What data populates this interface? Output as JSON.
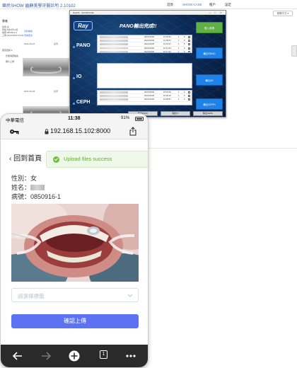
{
  "desktop": {
    "app_title": "樂民SHOW 齒顧美學牙醫診所 2.10102",
    "menu": [
      "首頁",
      "SHOW CASE",
      "帳戶",
      "設定"
    ],
    "lang_button": "繁體中文 ▾",
    "patient_heading": "患者",
    "patient_lines": [
      "性別:女",
      "年齡:5歲2月13日",
      "病歷:0850916-1",
      "上傳:2021/09/06 03:25"
    ],
    "links": [
      "資料看板",
      "查看更多"
    ],
    "menu_items": [
      "首頁選擇 ▾",
      "影像病歷檔案",
      "圖片上傳"
    ],
    "dates": [
      "2021-09-07",
      "2021-09-06"
    ],
    "date_tags": [
      "全景",
      "全景"
    ]
  },
  "ray": {
    "titlebar": "Ray5/6 · SHOWCASE",
    "window_controls": [
      "—",
      "□",
      "✕"
    ],
    "logo": "Ray",
    "heading": "PANO輸出完成!!",
    "sections": [
      {
        "label": "PANO",
        "rows": [
          {
            "date": "2021/04/06",
            "time": "16:49:53",
            "a": "1",
            "b": "5"
          },
          {
            "date": "2021/04/06",
            "time": "10:38:57",
            "a": "1",
            "b": "5"
          },
          {
            "date": "2021/04/06",
            "time": "10:15:47",
            "a": "1",
            "b": "5"
          },
          {
            "date": "2021/04/06",
            "time": "10:12:53",
            "a": "1",
            "b": "5"
          },
          {
            "date": "2021/04/06",
            "time": "15:17:42",
            "a": "1",
            "b": "5"
          }
        ]
      },
      {
        "label": "IO",
        "rows": []
      },
      {
        "label": "CEPH",
        "rows": [
          {
            "date": "2021/04/06",
            "time": "16:42:40",
            "a": "1",
            "b": "6"
          },
          {
            "date": "2021/04/06",
            "time": "16:36:16",
            "a": "1",
            "b": "6"
          },
          {
            "date": "2021/04/06",
            "time": "16:28:87",
            "a": "1",
            "b": "6"
          }
        ]
      }
    ],
    "buttons": {
      "login": "登入查詢",
      "export_pano": "輸出PANO",
      "export_io": "輸出IO",
      "export_ceph": "輸出CEPH"
    },
    "bottom_buttons": [
      "輸出PANO",
      "輸出IO",
      "輸出CEPH"
    ]
  },
  "phone": {
    "status": {
      "carrier": "中華電信",
      "time": "11:38",
      "battery": "91%"
    },
    "url": "192.168.15.102:8000",
    "back_label": "回到首頁",
    "toast": {
      "message": "Upload files success",
      "color": "#67c23a"
    },
    "patient": {
      "gender_label": "性別：",
      "gender": "女",
      "name_label": "姓名：",
      "chart_label": "病號：",
      "chart_no": "0850916-1"
    },
    "select_placeholder": "請選擇標籤",
    "submit_label": "確認上傳",
    "tab_count": "1",
    "accent": "#5b72f2"
  }
}
